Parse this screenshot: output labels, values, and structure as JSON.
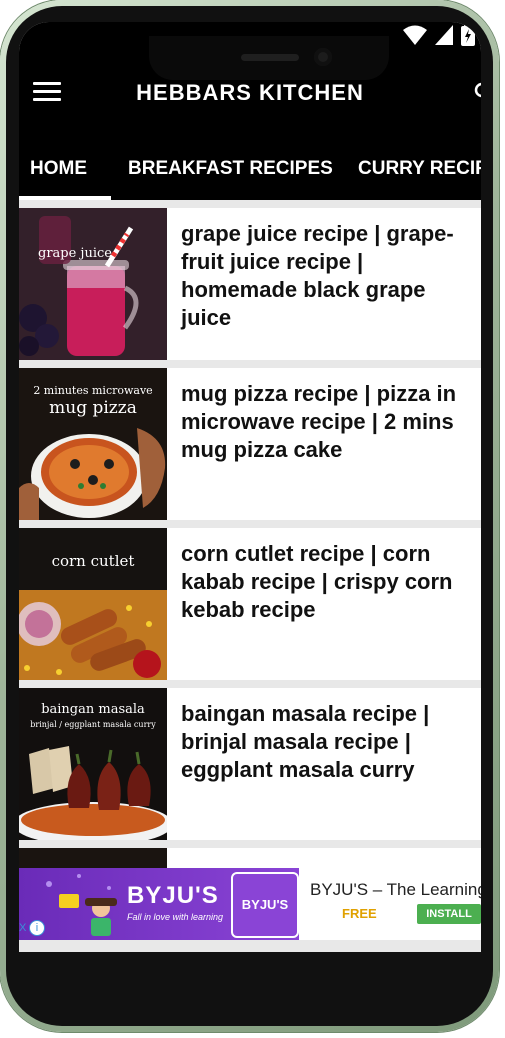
{
  "app": {
    "title": "HEBBARS KITCHEN"
  },
  "tabs": [
    {
      "label": "HOME",
      "active": true
    },
    {
      "label": "BREAKFAST RECIPES",
      "active": false
    },
    {
      "label": "CURRY RECIP",
      "active": false
    }
  ],
  "recipes": [
    {
      "title": "grape juice recipe | grape-fruit juice recipe | homemade black grape juice",
      "thumb_label": "grape juice"
    },
    {
      "title": "mug pizza recipe | pizza in microwave recipe | 2 mins mug pizza cake",
      "thumb_label_1": "2 minutes microwave",
      "thumb_label_2": "mug pizza"
    },
    {
      "title": "corn cutlet recipe | corn kabab recipe | crispy corn kebab recipe",
      "thumb_label": "corn cutlet"
    },
    {
      "title": "baingan masala recipe | brinjal masala recipe | eggplant masala curry",
      "thumb_label_1": "baingan masala",
      "thumb_label_2": "brinjal / eggplant masala curry"
    }
  ],
  "ad": {
    "brand": "BYJU'S",
    "tagline": "Fall in love with learning",
    "logo_text": "BYJU'S",
    "app_title": "BYJU'S – The Learning",
    "price": "FREE",
    "install_label": "INSTALL",
    "info": "i",
    "close": "X"
  },
  "colors": {
    "appbar": "#000000",
    "ad_purple": "#7a35c8",
    "install_green": "#4caf50",
    "free_gold": "#e0a100"
  }
}
